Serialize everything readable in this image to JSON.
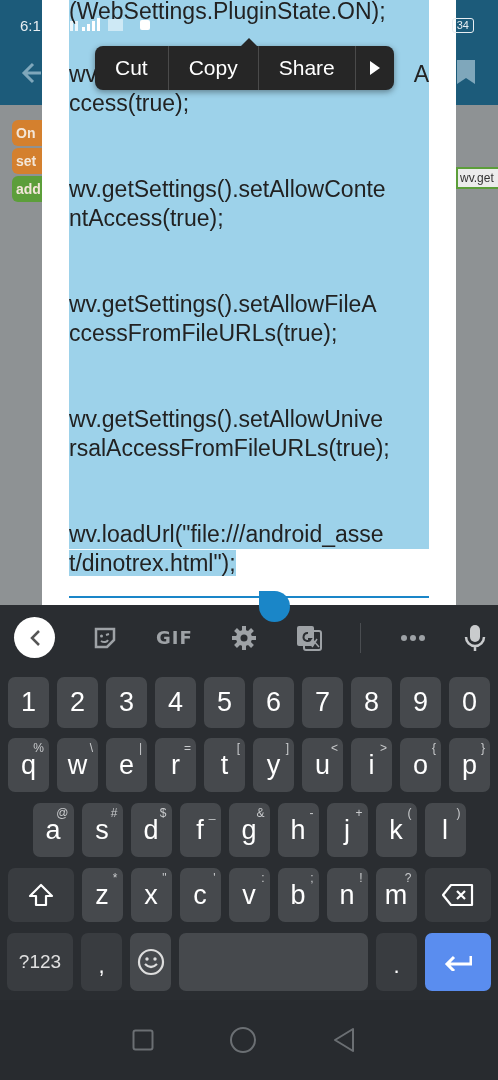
{
  "status_bar": {
    "time": "6:1",
    "battery": "34"
  },
  "app": {
    "blocks": [
      {
        "label": "On",
        "color": "#d4802e"
      },
      {
        "label": "set",
        "color": "#d4802e"
      },
      {
        "label": "add",
        "color": "#5c9e3a"
      }
    ],
    "side_block": "wv.get"
  },
  "editor": {
    "blocks": [
      {
        "lines": [
          {
            "text": "(WebSettings.PluginState.ON);"
          }
        ]
      },
      {
        "lines": [
          {
            "left": "wv",
            "right": "A"
          },
          {
            "text": "ccess(true);"
          }
        ]
      },
      {
        "lines": [
          {
            "text": "wv.getSettings().setAllowConte"
          },
          {
            "text": "ntAccess(true);"
          }
        ]
      },
      {
        "lines": [
          {
            "text": "wv.getSettings().setAllowFileA"
          },
          {
            "text": "ccessFromFileURLs(true);"
          }
        ]
      },
      {
        "lines": [
          {
            "text": "wv.getSettings().setAllowUnive"
          },
          {
            "text": "rsalAccessFromFileURLs(true);"
          }
        ]
      },
      {
        "lines": [
          {
            "text": "wv.loadUrl(\"file:///android_asse"
          },
          {
            "text": "t/dinotrex.html\");"
          }
        ]
      }
    ]
  },
  "context_menu": {
    "items": [
      {
        "kind": "text",
        "label": "Cut"
      },
      {
        "kind": "text",
        "label": "Copy"
      },
      {
        "kind": "text",
        "label": "Share"
      },
      {
        "kind": "more"
      }
    ]
  },
  "keyboard": {
    "gif_label": "GIF",
    "rows": [
      {
        "keys": [
          {
            "kind": "char",
            "label": "1"
          },
          {
            "kind": "char",
            "label": "2"
          },
          {
            "kind": "char",
            "label": "3"
          },
          {
            "kind": "char",
            "label": "4"
          },
          {
            "kind": "char",
            "label": "5"
          },
          {
            "kind": "char",
            "label": "6"
          },
          {
            "kind": "char",
            "label": "7"
          },
          {
            "kind": "char",
            "label": "8"
          },
          {
            "kind": "char",
            "label": "9"
          },
          {
            "kind": "char",
            "label": "0"
          }
        ]
      },
      {
        "keys": [
          {
            "kind": "char",
            "label": "q",
            "hint": "%"
          },
          {
            "kind": "char",
            "label": "w",
            "hint": "\\"
          },
          {
            "kind": "char",
            "label": "e",
            "hint": "|"
          },
          {
            "kind": "char",
            "label": "r",
            "hint": "="
          },
          {
            "kind": "char",
            "label": "t",
            "hint": "["
          },
          {
            "kind": "char",
            "label": "y",
            "hint": "]"
          },
          {
            "kind": "char",
            "label": "u",
            "hint": "<"
          },
          {
            "kind": "char",
            "label": "i",
            "hint": ">"
          },
          {
            "kind": "char",
            "label": "o",
            "hint": "{"
          },
          {
            "kind": "char",
            "label": "p",
            "hint": "}"
          }
        ]
      },
      {
        "keys": [
          {
            "kind": "char",
            "label": "a",
            "hint": "@"
          },
          {
            "kind": "char",
            "label": "s",
            "hint": "#"
          },
          {
            "kind": "char",
            "label": "d",
            "hint": "$"
          },
          {
            "kind": "char",
            "label": "f",
            "hint": "_"
          },
          {
            "kind": "char",
            "label": "g",
            "hint": "&"
          },
          {
            "kind": "char",
            "label": "h",
            "hint": "-"
          },
          {
            "kind": "char",
            "label": "j",
            "hint": "+"
          },
          {
            "kind": "char",
            "label": "k",
            "hint": "("
          },
          {
            "kind": "char",
            "label": "l",
            "hint": ")"
          }
        ]
      },
      {
        "keys": [
          {
            "kind": "shift"
          },
          {
            "kind": "char",
            "label": "z",
            "hint": "*"
          },
          {
            "kind": "char",
            "label": "x",
            "hint": "\""
          },
          {
            "kind": "char",
            "label": "c",
            "hint": "'"
          },
          {
            "kind": "char",
            "label": "v",
            "hint": ":"
          },
          {
            "kind": "char",
            "label": "b",
            "hint": ";"
          },
          {
            "kind": "char",
            "label": "n",
            "hint": "!"
          },
          {
            "kind": "char",
            "label": "m",
            "hint": "?"
          },
          {
            "kind": "backspace"
          }
        ]
      },
      {
        "keys": [
          {
            "kind": "symbols",
            "label": "?123"
          },
          {
            "kind": "punct",
            "label": ","
          },
          {
            "kind": "emoji"
          },
          {
            "kind": "space"
          },
          {
            "kind": "punct",
            "label": "."
          },
          {
            "kind": "enter"
          }
        ]
      }
    ]
  }
}
